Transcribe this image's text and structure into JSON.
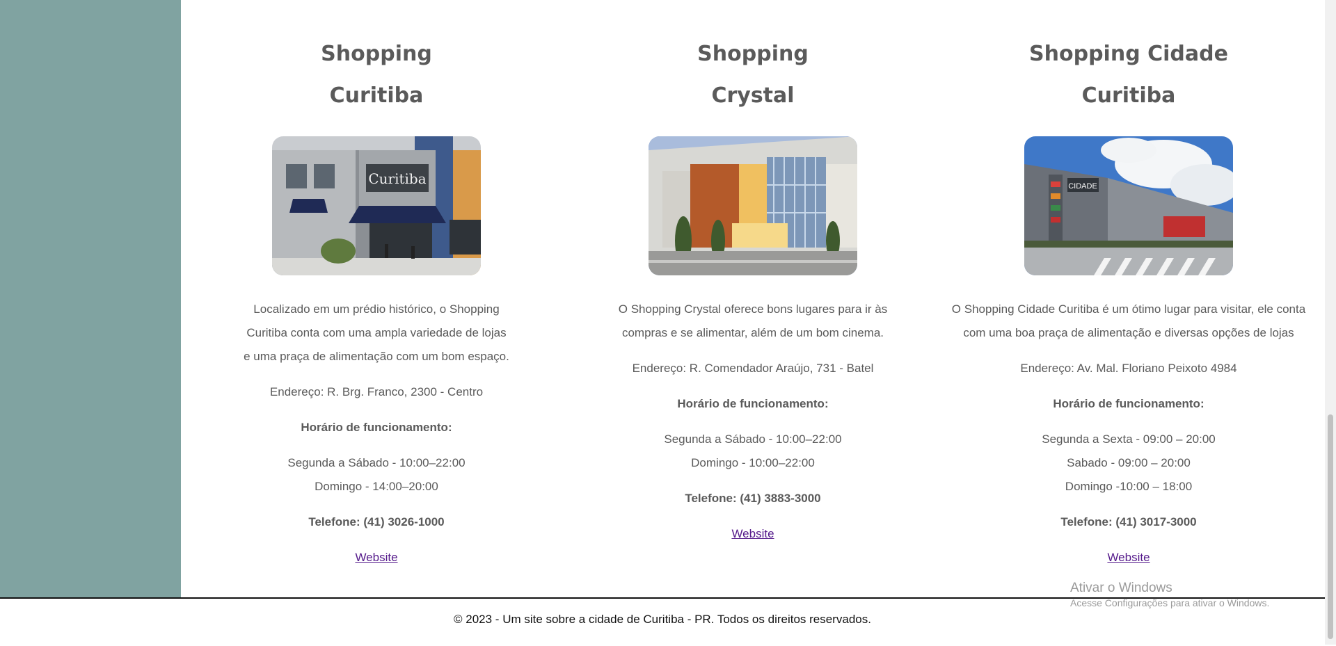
{
  "malls": [
    {
      "title_line1": "Shopping",
      "title_line2": "Curitiba",
      "image_alt": "Fachada do Shopping Curitiba",
      "description": [
        "Localizado em um prédio histórico, o Shopping",
        "Curitiba conta com uma ampla variedade de lojas",
        "e uma praça de alimentação com um bom espaço."
      ],
      "address": "Endereço: R. Brg. Franco, 2300 - Centro",
      "hours_title": "Horário de funcionamento:",
      "hours": [
        "Segunda a Sábado - 10:00–22:00",
        "Domingo - 14:00–20:00"
      ],
      "phone": "Telefone: (41) 3026-1000",
      "website_label": "Website"
    },
    {
      "title_line1": "Shopping",
      "title_line2": "Crystal",
      "image_alt": "Fachada do Shopping Crystal",
      "description": [
        "O Shopping Crystal oferece bons lugares para ir às",
        "compras e se alimentar, além de um bom cinema."
      ],
      "address": "Endereço: R. Comendador Araújo, 731 - Batel",
      "hours_title": "Horário de funcionamento:",
      "hours": [
        "Segunda a Sábado - 10:00–22:00",
        "Domingo - 10:00–22:00"
      ],
      "phone": "Telefone: (41) 3883-3000",
      "website_label": "Website"
    },
    {
      "title_line1": "Shopping Cidade",
      "title_line2": "Curitiba",
      "image_alt": "Vista do Shopping Cidade Curitiba",
      "description": [
        "O Shopping Cidade Curitiba é um ótimo lugar para visitar, ele conta",
        "com uma boa praça de alimentação e diversas opções de lojas"
      ],
      "address": "Endereço: Av. Mal. Floriano Peixoto 4984",
      "hours_title": "Horário de funcionamento:",
      "hours": [
        "Segunda a Sexta - 09:00 – 20:00",
        "Sabado - 09:00 – 20:00",
        "Domingo -10:00 – 18:00"
      ],
      "phone": "Telefone: (41) 3017-3000",
      "website_label": "Website"
    }
  ],
  "photo_signs": {
    "curitiba": "Curitiba",
    "cidade": "CIDADE"
  },
  "footer": {
    "text": "© 2023 - Um site sobre a cidade de Curitiba - PR. Todos os direitos reservados."
  },
  "watermark": {
    "title": "Ativar o Windows",
    "subtitle": "Acesse Configurações para ativar o Windows."
  },
  "colors": {
    "sidebar": "#80a3a1",
    "text": "#5a5a5a",
    "link": "#551a8b"
  }
}
